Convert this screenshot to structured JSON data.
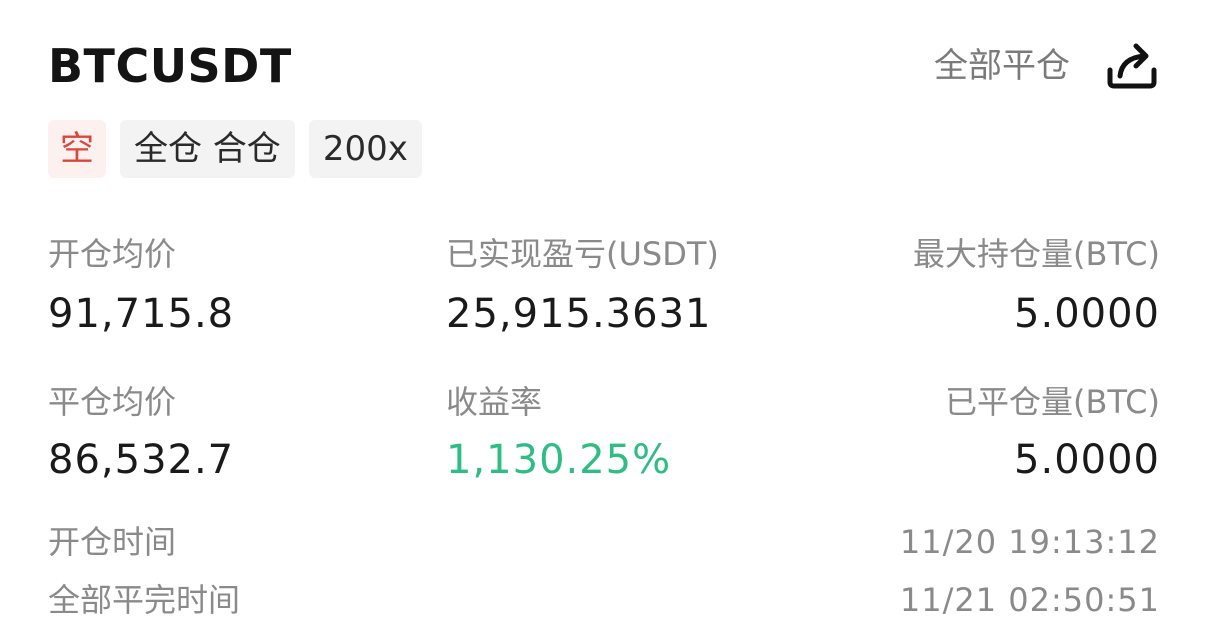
{
  "header": {
    "symbol": "BTCUSDT",
    "close_all_label": "全部平仓",
    "share_icon": "share-icon"
  },
  "tags": {
    "side": "空",
    "margin_mode": "全仓 合仓",
    "leverage": "200x"
  },
  "colors": {
    "short": "#d9463c",
    "profit": "#2ebd85"
  },
  "stats": {
    "open_avg_label": "开仓均价",
    "open_avg_value": "91,715.8",
    "realized_pnl_label": "已实现盈亏(USDT)",
    "realized_pnl_value": "25,915.3631",
    "max_position_label": "最大持仓量(BTC)",
    "max_position_value": "5.0000",
    "close_avg_label": "平仓均价",
    "close_avg_value": "86,532.7",
    "roi_label": "收益率",
    "roi_value": "1,130.25%",
    "closed_qty_label": "已平仓量(BTC)",
    "closed_qty_value": "5.0000"
  },
  "times": {
    "open_time_label": "开仓时间",
    "open_time_value": "11/20 19:13:12",
    "close_time_label": "全部平完时间",
    "close_time_value": "11/21 02:50:51"
  }
}
